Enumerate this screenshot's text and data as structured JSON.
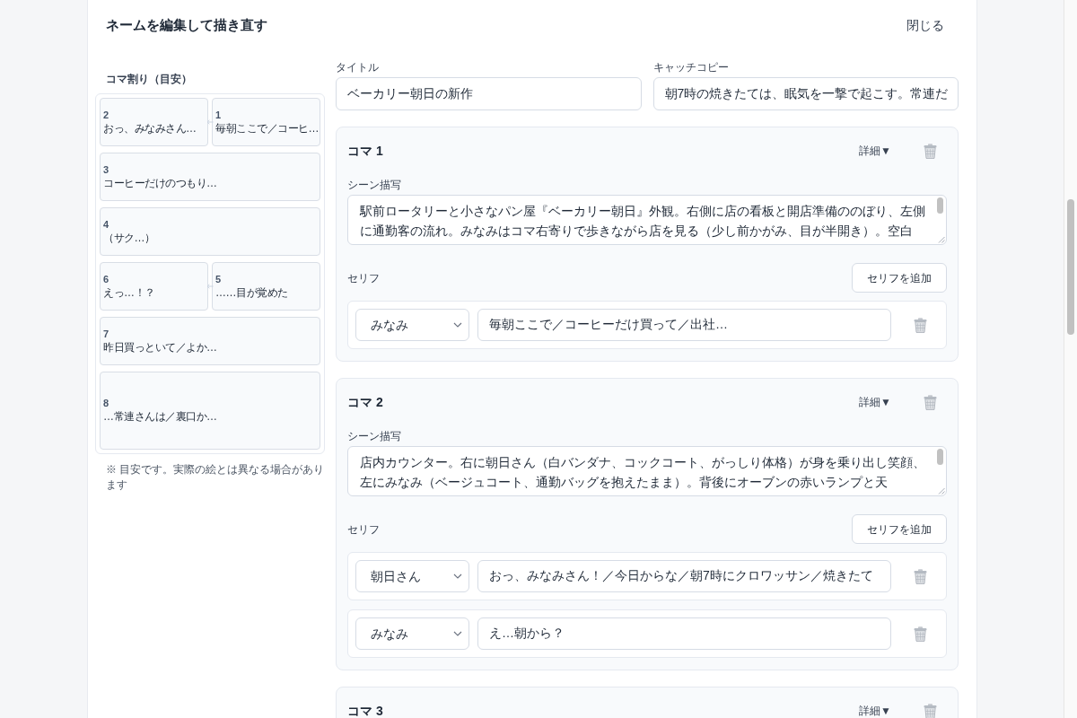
{
  "dialog": {
    "title": "ネームを編集して描き直す",
    "close_label": "閉じる"
  },
  "layout_preview": {
    "label": "コマ割り（目安）",
    "rows": [
      {
        "kind": "split",
        "panels": [
          {
            "number": "2",
            "text": "おっ、みなみさん…"
          },
          {
            "number": "1",
            "text": "毎朝ここで／コーヒ…"
          }
        ]
      },
      {
        "kind": "full",
        "panels": [
          {
            "number": "3",
            "text": "コーヒーだけのつもり…"
          }
        ]
      },
      {
        "kind": "full",
        "panels": [
          {
            "number": "4",
            "text": "（サク…）"
          }
        ]
      },
      {
        "kind": "split",
        "panels": [
          {
            "number": "6",
            "text": "えっ…！？"
          },
          {
            "number": "5",
            "text": "……目が覚めた"
          }
        ]
      },
      {
        "kind": "full",
        "panels": [
          {
            "number": "7",
            "text": "昨日買っといて／よか…"
          }
        ]
      },
      {
        "kind": "tall",
        "panels": [
          {
            "number": "8",
            "text": "…常連さんは／裏口か…"
          }
        ]
      }
    ],
    "note": "※ 目安です。実際の絵とは異なる場合があります"
  },
  "fields": [
    {
      "label": "タイトル",
      "value": "ベーカリー朝日の新作"
    },
    {
      "label": "キャッチコピー",
      "value": "朝7時の焼きたては、眠気を一撃で起こす。常連だ"
    }
  ],
  "panels": [
    {
      "title": "コマ 1",
      "details_label": "詳細▼",
      "scene_label": "シーン描写",
      "scene": "駅前ロータリーと小さなパン屋『ベーカリー朝日』外観。右側に店の看板と開店準備ののぼり、左側に通勤客の流れ。みなみはコマ右寄りで歩きながら店を見る（少し前かがみ、目が半開き）。空白",
      "lines_label": "セリフ",
      "add_line_label": "セリフを追加",
      "lines": [
        {
          "speaker": "みなみ",
          "text": "毎朝ここで／コーヒーだけ買って／出社…"
        }
      ]
    },
    {
      "title": "コマ 2",
      "details_label": "詳細▼",
      "scene_label": "シーン描写",
      "scene": "店内カウンター。右に朝日さん（白バンダナ、コックコート、がっしり体格）が身を乗り出し笑顔、左にみなみ（ベージュコート、通勤バッグを抱えたまま）。背後にオーブンの赤いランプと天",
      "lines_label": "セリフ",
      "add_line_label": "セリフを追加",
      "lines": [
        {
          "speaker": "朝日さん",
          "text": "おっ、みなみさん！／今日からな／朝7時にクロワッサン／焼きたて"
        },
        {
          "speaker": "みなみ",
          "text": "え…朝から？"
        }
      ]
    },
    {
      "title": "コマ 3",
      "details_label": "詳細▼"
    }
  ]
}
